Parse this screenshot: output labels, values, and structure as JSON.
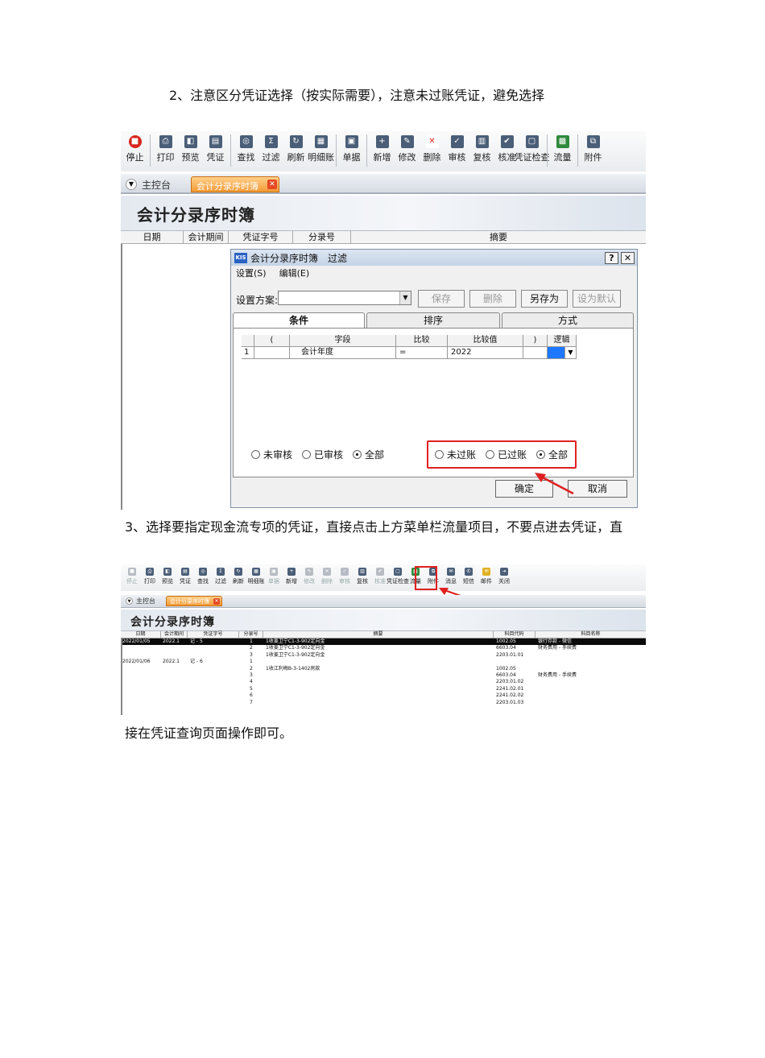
{
  "step2_text": "2、注意区分凭证选择（按实际需要），注意未过账凭证，避免选择",
  "step3_text_a": "3、选择要指定现金流专项的凭证，直接点击上方菜单栏流量项目，不要点进去凭证，直",
  "step3_text_b": "接在凭证查询页面操作即可。",
  "screenshot1": {
    "toolbar": [
      {
        "label": "停止",
        "icon": "stop-icon"
      },
      {
        "label": "打印",
        "icon": "print-icon"
      },
      {
        "label": "预览",
        "icon": "preview-icon"
      },
      {
        "label": "凭证",
        "icon": "voucher-icon"
      },
      {
        "label": "查找",
        "icon": "binoculars-icon"
      },
      {
        "label": "过滤",
        "icon": "filter-icon"
      },
      {
        "label": "刷新",
        "icon": "refresh-icon"
      },
      {
        "label": "明细账",
        "icon": "ledger-icon"
      },
      {
        "label": "单据",
        "icon": "document-icon"
      },
      {
        "label": "新增",
        "icon": "add-icon"
      },
      {
        "label": "修改",
        "icon": "edit-icon"
      },
      {
        "label": "删除",
        "icon": "delete-icon"
      },
      {
        "label": "审核",
        "icon": "audit-icon"
      },
      {
        "label": "复核",
        "icon": "recheck-icon"
      },
      {
        "label": "核准",
        "icon": "approve-icon"
      },
      {
        "label": "凭证检查",
        "icon": "voucher-check-icon"
      },
      {
        "label": "流量",
        "icon": "cashflow-icon"
      },
      {
        "label": "附件",
        "icon": "attachment-icon"
      }
    ],
    "tab_home": "主控台",
    "tab_active": "会计分录序时簿",
    "banner_title": "会计分录序时簿",
    "columns": [
      "日期",
      "会计期间",
      "凭证字号",
      "分录号",
      "摘要"
    ],
    "dialog": {
      "title": "会计分录序时簿　过滤",
      "menu": [
        "设置(S)",
        "编辑(E)"
      ],
      "scheme_label": "设置方案:",
      "buttons": [
        "保存",
        "删除",
        "另存为",
        "设为默认"
      ],
      "tabs": [
        "条件",
        "排序",
        "方式"
      ],
      "grid_headers": [
        "(",
        "字段",
        "比较",
        "比较值",
        ")",
        "逻辑"
      ],
      "grid_row": {
        "no": "1",
        "field": "会计年度",
        "op": "=",
        "value": "2022"
      },
      "audit_radios": [
        "未审核",
        "已审核",
        "全部"
      ],
      "audit_selected": "全部",
      "post_radios": [
        "未过账",
        "已过账",
        "全部"
      ],
      "post_selected": "全部",
      "ok": "确定",
      "cancel": "取消"
    }
  },
  "screenshot2": {
    "toolbar": [
      {
        "label": "停止",
        "icon": "stop-icon",
        "dim": true
      },
      {
        "label": "打印",
        "icon": "print-icon"
      },
      {
        "label": "预览",
        "icon": "preview-icon"
      },
      {
        "label": "凭证",
        "icon": "voucher-icon"
      },
      {
        "label": "查找",
        "icon": "binoculars-icon"
      },
      {
        "label": "过滤",
        "icon": "filter-icon"
      },
      {
        "label": "刷新",
        "icon": "refresh-icon"
      },
      {
        "label": "明细账",
        "icon": "ledger-icon"
      },
      {
        "label": "单据",
        "icon": "document-icon",
        "dim": true
      },
      {
        "label": "新增",
        "icon": "add-icon"
      },
      {
        "label": "修改",
        "icon": "edit-icon",
        "dim": true
      },
      {
        "label": "删除",
        "icon": "delete-icon",
        "dim": true
      },
      {
        "label": "审核",
        "icon": "audit-icon",
        "dim": true
      },
      {
        "label": "复核",
        "icon": "recheck-icon"
      },
      {
        "label": "核准",
        "icon": "approve-icon",
        "dim": true
      },
      {
        "label": "凭证检查",
        "icon": "voucher-check-icon"
      },
      {
        "label": "流量",
        "icon": "cashflow-icon"
      },
      {
        "label": "附件",
        "icon": "attachment-icon"
      },
      {
        "label": "消息",
        "icon": "message-icon"
      },
      {
        "label": "短信",
        "icon": "sms-icon"
      },
      {
        "label": "邮件",
        "icon": "mail-icon"
      },
      {
        "label": "关闭",
        "icon": "close-door-icon"
      }
    ],
    "tab_home": "主控台",
    "tab_active": "会计分录序时簿",
    "banner_title": "会计分录序时簿",
    "columns": [
      "日期",
      "会计期间",
      "凭证字号",
      "分录号",
      "摘要",
      "科目代码",
      "科目名称"
    ],
    "rows": [
      {
        "date": "2022/01/05",
        "period": "2022.1",
        "voucher": "记 - 5",
        "no": "1",
        "summary": "1收姜卫宁C1-3-902定向金",
        "code": "1002.05",
        "name": "银行存款 - 微信",
        "sel": true
      },
      {
        "date": "",
        "period": "",
        "voucher": "",
        "no": "2",
        "summary": "1收姜卫宁C1-3-902定向金",
        "code": "6603.04",
        "name": "财务费用 - 手续费",
        "sel": false
      },
      {
        "date": "",
        "period": "",
        "voucher": "",
        "no": "3",
        "summary": "1收姜卫宁C1-3-902定向金",
        "code": "2203.01.01",
        "name": "",
        "sel": false
      },
      {
        "date": "2022/01/06",
        "period": "2022.1",
        "voucher": "记 - 6",
        "no": "1",
        "summary": "",
        "code": "",
        "name": "",
        "sel": false
      },
      {
        "date": "",
        "period": "",
        "voucher": "",
        "no": "2",
        "summary": "1收江利梅B-3-1402房款",
        "code": "1002.05",
        "name": "",
        "sel": false
      },
      {
        "date": "",
        "period": "",
        "voucher": "",
        "no": "3",
        "summary": "",
        "code": "6603.04",
        "name": "财务费用 - 手续费",
        "sel": false
      },
      {
        "date": "",
        "period": "",
        "voucher": "",
        "no": "4",
        "summary": "",
        "code": "2203.01.02",
        "name": "",
        "sel": false
      },
      {
        "date": "",
        "period": "",
        "voucher": "",
        "no": "5",
        "summary": "",
        "code": "2241.02.01",
        "name": "",
        "sel": false
      },
      {
        "date": "",
        "period": "",
        "voucher": "",
        "no": "6",
        "summary": "",
        "code": "2241.02.02",
        "name": "",
        "sel": false
      },
      {
        "date": "",
        "period": "",
        "voucher": "",
        "no": "7",
        "summary": "",
        "code": "2203.01.03",
        "name": "",
        "sel": false
      }
    ]
  }
}
